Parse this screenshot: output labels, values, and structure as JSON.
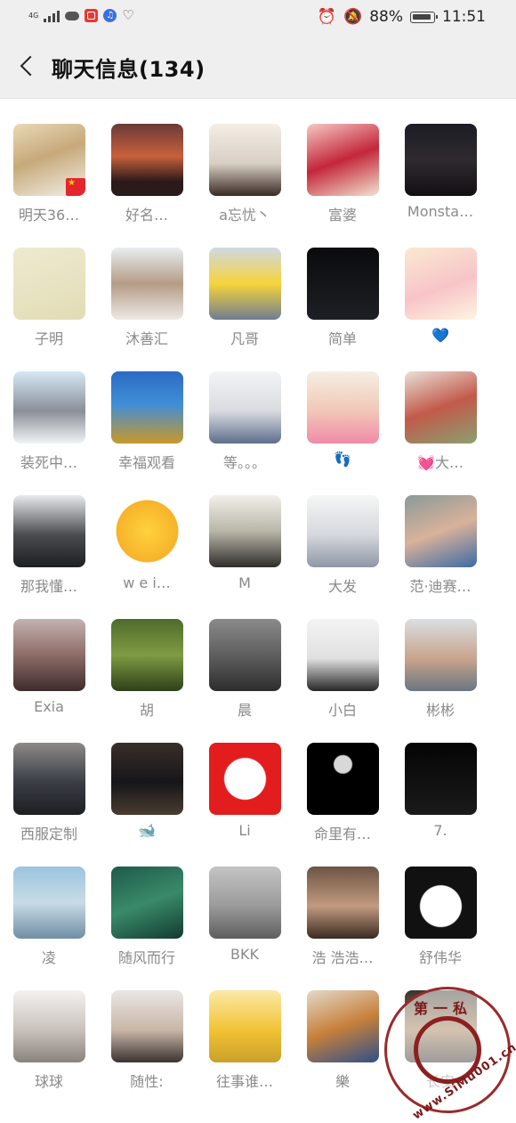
{
  "status": {
    "network": "4G",
    "battery_percent": "88%",
    "time": "11:51"
  },
  "header": {
    "title": "聊天信息(134)"
  },
  "members": [
    {
      "name": "明天36…",
      "bg": "linear-gradient(160deg,#e8d9b8 0%,#c7a97a 45%,#f2efe8 100%)"
    },
    {
      "name": "好名…",
      "bg": "linear-gradient(180deg,#6b3a3a 0%,#c8603b 45%,#2a1a1a 80%)"
    },
    {
      "name": "a忘忧丶",
      "bg": "linear-gradient(180deg,#f4eee6 0%,#d8cfc4 55%,#3a2a24 100%)"
    },
    {
      "name": "富婆",
      "bg": "linear-gradient(160deg,#f5c9c4 0%,#c4263a 50%,#f2e3d0 100%)"
    },
    {
      "name": "Monsta…",
      "bg": "linear-gradient(180deg,#1c1c24 0%,#2f2a30 50%,#120f12 100%)"
    },
    {
      "name": "子明",
      "bg": "linear-gradient(160deg,#eeead0 0%,#e2dcb4 100%)"
    },
    {
      "name": "沐善汇",
      "bg": "linear-gradient(180deg,#e7eef0 0%,#b59c86 50%,#ede9e5 100%)"
    },
    {
      "name": "凡哥",
      "bg": "linear-gradient(180deg,#cfd8e4 0%,#f6d43a 50%,#6e7d92 100%)"
    },
    {
      "name": "简单",
      "bg": "linear-gradient(180deg,#0b0b0d 0%,#1c1f24 100%)"
    },
    {
      "name": "💙",
      "bg": "linear-gradient(160deg,#fbe9d2 0%,#f7c4c8 55%,#fff4e0 100%)"
    },
    {
      "name": "装死中…",
      "bg": "linear-gradient(180deg,#d6e8f4 0%,#8a8f98 55%,#f2f4f6 100%)"
    },
    {
      "name": "幸福观看",
      "bg": "linear-gradient(180deg,#2b6bc2 0%,#3f8ed8 45%,#c9982a 100%)"
    },
    {
      "name": "等。。。",
      "bg": "linear-gradient(180deg,#f3f4f6 0%,#d9dbe0 55%,#5c6e8c 100%)"
    },
    {
      "name": "👣",
      "bg": "linear-gradient(180deg,#f4efe2 0%,#f2c7b7 55%,#f08aa8 100%)"
    },
    {
      "name": "💓大…",
      "bg": "linear-gradient(160deg,#eae0d8 0%,#c25a4a 50%,#8aa070 100%)"
    },
    {
      "name": "那我懂…",
      "bg": "linear-gradient(180deg,#e8eaec 0%,#4a4c50 55%,#1e1f22 100%)"
    },
    {
      "name": "w e i…",
      "bg": "radial-gradient(circle at 50% 50%,#ffd23d 0%,#f6b32a 60%,#ffffff 62%)"
    },
    {
      "name": "M",
      "bg": "linear-gradient(180deg,#f2f0ea 0%,#b9b5a8 50%,#2e2d2a 100%)"
    },
    {
      "name": "大发",
      "bg": "linear-gradient(180deg,#f6f6f6 0%,#d6d8dc 55%,#8e96a6 100%)"
    },
    {
      "name": "范·迪赛…",
      "bg": "linear-gradient(160deg,#8a9a98 0%,#d9b29a 50%,#3d6aa5 100%)"
    },
    {
      "name": "Exia",
      "bg": "linear-gradient(180deg,#c4b2b0 0%,#8e6c68 50%,#3d2c2c 100%)"
    },
    {
      "name": "胡",
      "bg": "linear-gradient(180deg,#4e6b2c 0%,#7f9b43 50%,#2d3f18 100%)"
    },
    {
      "name": "晨",
      "bg": "linear-gradient(180deg,#8a8a8a 0%,#5a5a5a 55%,#2d2d2d 100%)"
    },
    {
      "name": "小白",
      "bg": "linear-gradient(180deg,#f4f4f4 0%,#e0e0e0 55%,#262626 100%)"
    },
    {
      "name": "彬彬",
      "bg": "linear-gradient(180deg,#d9dfe2 0%,#c9a48c 55%,#6a7680 100%)"
    },
    {
      "name": "西服定制",
      "bg": "linear-gradient(180deg,#8c8a86 0%,#3a3d44 55%,#1c1e22 100%)"
    },
    {
      "name": "🐋",
      "bg": "linear-gradient(180deg,#3a2e28 0%,#16161a 55%,#4a3c30 100%)"
    },
    {
      "name": "Li",
      "bg": "radial-gradient(circle at 50% 50%,#ffffff 0%,#ffffff 40%,#e31d1d 42%)"
    },
    {
      "name": "命里有…",
      "bg": "radial-gradient(circle at 50% 30%,#d8d8d8 0%,#d8d8d8 14%,#000000 16%)"
    },
    {
      "name": "7.",
      "bg": "linear-gradient(180deg,#050505 0%,#1a1a1a 100%)"
    },
    {
      "name": "凌",
      "bg": "linear-gradient(180deg,#9bc4e0 0%,#c9dbe6 50%,#6f8ea4 100%)"
    },
    {
      "name": "随风而行",
      "bg": "linear-gradient(160deg,#1d5a4a 0%,#3a8a6a 50%,#123a30 100%)"
    },
    {
      "name": "BKK",
      "bg": "linear-gradient(180deg,#c4c4c4 0%,#9a9a9a 55%,#5e5e5e 100%)"
    },
    {
      "name": "浩 浩浩…",
      "bg": "linear-gradient(180deg,#6c5444 0%,#c29a80 55%,#3a2a20 100%)"
    },
    {
      "name": "舒伟华",
      "bg": "radial-gradient(circle at 50% 55%,#ffffff 0%,#ffffff 38%,#111111 40%)"
    },
    {
      "name": "球球",
      "bg": "linear-gradient(180deg,#f4f2f0 0%,#c9c2bc 55%,#8a827c 100%)"
    },
    {
      "name": "随性:",
      "bg": "linear-gradient(180deg,#e9e7e4 0%,#c9b6a8 55%,#3a3330 100%)"
    },
    {
      "name": "往事谁…",
      "bg": "linear-gradient(180deg,#fbe9a8 0%,#f2c334 55%,#caa02a 100%)"
    },
    {
      "name": "樂",
      "bg": "linear-gradient(160deg,#e3d9ca 0%,#c7803a 50%,#2f4f8a 100%)"
    },
    {
      "name": "长安",
      "bg": "linear-gradient(180deg,#3a342e 0%,#a07a50 55%,#2a2420 100%)"
    }
  ],
  "watermark": {
    "text": "www.SiMu001.cn",
    "top_text": "第一私"
  }
}
